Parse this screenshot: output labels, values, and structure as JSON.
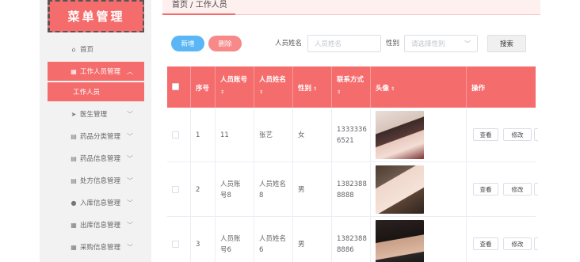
{
  "logo": {
    "text": "菜单管理"
  },
  "sidebar": {
    "items": [
      {
        "label": "首页",
        "icon": "home-icon"
      },
      {
        "label": "工作人员管理",
        "icon": "grid-icon",
        "active": true
      },
      {
        "label": "工作人员",
        "sub": true
      },
      {
        "label": "医生管理",
        "icon": "send-icon"
      },
      {
        "label": "药品分类管理",
        "icon": "clipboard-icon"
      },
      {
        "label": "药品信息管理",
        "icon": "clipboard-icon"
      },
      {
        "label": "处方信息管理",
        "icon": "clipboard-icon"
      },
      {
        "label": "入库信息管理",
        "icon": "user-icon"
      },
      {
        "label": "出库信息管理",
        "icon": "grid-icon"
      },
      {
        "label": "采购信息管理",
        "icon": "grid-icon"
      }
    ]
  },
  "breadcrumb": {
    "text": "首页 / 工作人员"
  },
  "toolbar": {
    "add_label": "新增",
    "delete_label": "删除",
    "name_label": "人员姓名",
    "name_placeholder": "人员姓名",
    "gender_label": "性别",
    "gender_placeholder": "请选择性别",
    "search_label": "搜索"
  },
  "table": {
    "headers": {
      "index": "序号",
      "account": "人员账号",
      "name": "人员姓名",
      "gender": "性别",
      "phone": "联系方式",
      "avatar": "头像",
      "actions": "操作"
    },
    "sort_glyph": "⇕",
    "rows": [
      {
        "index": "1",
        "account": "11",
        "name": "张艺",
        "gender": "女",
        "phone": "13333366521",
        "phone_a": "1333336",
        "phone_b": "6521"
      },
      {
        "index": "2",
        "account_a": "人员账",
        "account_b": "号",
        "account_c": "8",
        "name_a": "人员姓名",
        "name_b": "8",
        "gender": "男",
        "phone_a": "1382388",
        "phone_b": "8888"
      },
      {
        "index": "3",
        "account_a": "人员账",
        "account_b": "号",
        "account_c": "6",
        "name_a": "人员姓名",
        "name_b": "6",
        "gender": "男",
        "phone_a": "1382388",
        "phone_b": "8886"
      }
    ],
    "view_label": "查看",
    "edit_label": "修改"
  },
  "colors": {
    "accent": "#f56c6c",
    "primary": "#5ab6f5"
  }
}
